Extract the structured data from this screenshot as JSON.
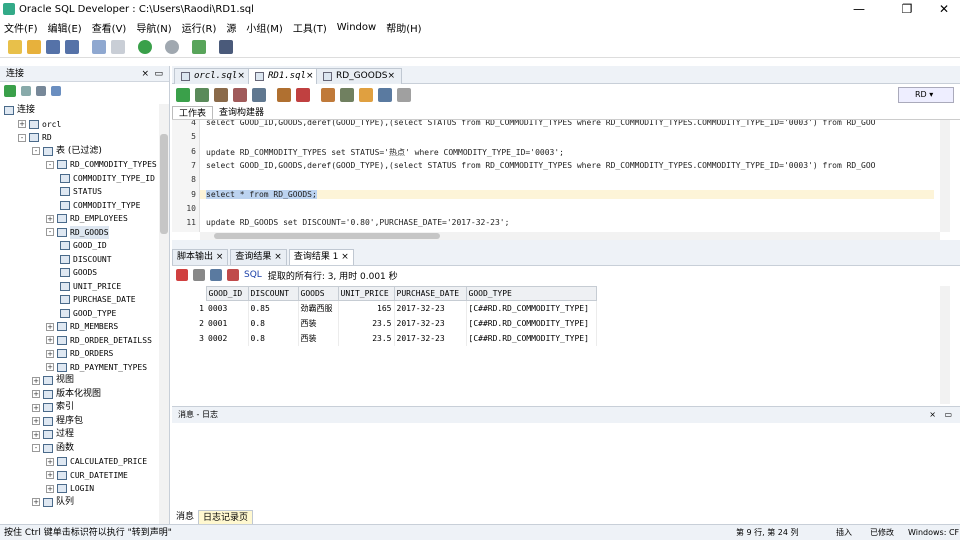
{
  "window": {
    "title": "Oracle SQL Developer : C:\\Users\\Raodi\\RD1.sql"
  },
  "menu": [
    "文件(F)",
    "编辑(E)",
    "查看(V)",
    "导航(N)",
    "运行(R)",
    "源",
    "小组(M)",
    "工具(T)",
    "Window",
    "帮助(H)"
  ],
  "connections": {
    "header": "连接",
    "tree": [
      {
        "label": "连接",
        "mono": false,
        "exp": "",
        "level": 0
      },
      {
        "label": "orcl",
        "mono": true,
        "exp": "+",
        "level": 1
      },
      {
        "label": "RD",
        "mono": true,
        "exp": "-",
        "level": 1
      },
      {
        "label": "表 (已过滤)",
        "mono": false,
        "exp": "-",
        "level": 2
      },
      {
        "label": "RD_COMMODITY_TYPES",
        "mono": true,
        "exp": "-",
        "level": 3
      },
      {
        "label": "COMMODITY_TYPE_ID",
        "mono": true,
        "exp": "",
        "level": 4
      },
      {
        "label": "STATUS",
        "mono": true,
        "exp": "",
        "level": 4
      },
      {
        "label": "COMMODITY_TYPE",
        "mono": true,
        "exp": "",
        "level": 4
      },
      {
        "label": "RD_EMPLOYEES",
        "mono": true,
        "exp": "+",
        "level": 3
      },
      {
        "label": "RD_GOODS",
        "mono": true,
        "exp": "-",
        "level": 3,
        "sel": true
      },
      {
        "label": "GOOD_ID",
        "mono": true,
        "exp": "",
        "level": 4
      },
      {
        "label": "DISCOUNT",
        "mono": true,
        "exp": "",
        "level": 4
      },
      {
        "label": "GOODS",
        "mono": true,
        "exp": "",
        "level": 4
      },
      {
        "label": "UNIT_PRICE",
        "mono": true,
        "exp": "",
        "level": 4
      },
      {
        "label": "PURCHASE_DATE",
        "mono": true,
        "exp": "",
        "level": 4
      },
      {
        "label": "GOOD_TYPE",
        "mono": true,
        "exp": "",
        "level": 4
      },
      {
        "label": "RD_MEMBERS",
        "mono": true,
        "exp": "+",
        "level": 3
      },
      {
        "label": "RD_ORDER_DETAILSS",
        "mono": true,
        "exp": "+",
        "level": 3
      },
      {
        "label": "RD_ORDERS",
        "mono": true,
        "exp": "+",
        "level": 3
      },
      {
        "label": "RD_PAYMENT_TYPES",
        "mono": true,
        "exp": "+",
        "level": 3
      },
      {
        "label": "视图",
        "mono": false,
        "exp": "+",
        "level": 2
      },
      {
        "label": "版本化视图",
        "mono": false,
        "exp": "+",
        "level": 2
      },
      {
        "label": "索引",
        "mono": false,
        "exp": "+",
        "level": 2
      },
      {
        "label": "程序包",
        "mono": false,
        "exp": "+",
        "level": 2
      },
      {
        "label": "过程",
        "mono": false,
        "exp": "+",
        "level": 2
      },
      {
        "label": "函数",
        "mono": false,
        "exp": "-",
        "level": 2
      },
      {
        "label": "CALCULATED_PRICE",
        "mono": true,
        "exp": "+",
        "level": 3
      },
      {
        "label": "CUR_DATETIME",
        "mono": true,
        "exp": "+",
        "level": 3
      },
      {
        "label": "LOGIN",
        "mono": true,
        "exp": "+",
        "level": 3
      },
      {
        "label": "队列",
        "mono": false,
        "exp": "+",
        "level": 2
      }
    ]
  },
  "editor_tabs": [
    {
      "label": "orcl.sql",
      "italic": true
    },
    {
      "label": "RD1.sql",
      "italic": true,
      "active": true
    },
    {
      "label": "RD_GOODS",
      "italic": false
    }
  ],
  "connection_select": "RD",
  "sub_tabs": [
    "工作表",
    "查询构建器"
  ],
  "code_lines": [
    {
      "n": "4",
      "text": "select GOOD_ID,GOODS,deref(GOOD_TYPE),(select STATUS from RD_COMMODITY_TYPES where RD_COMMODITY_TYPES.COMMODITY_TYPE_ID='0003') from RD_GOO"
    },
    {
      "n": "5",
      "text": ""
    },
    {
      "n": "6",
      "text": "update RD_COMMODITY_TYPES set STATUS='热点' where COMMODITY_TYPE_ID='0003';"
    },
    {
      "n": "7",
      "text": "select GOOD_ID,GOODS,deref(GOOD_TYPE),(select STATUS from RD_COMMODITY_TYPES where RD_COMMODITY_TYPES.COMMODITY_TYPE_ID='0003') from RD_GOO"
    },
    {
      "n": "8",
      "text": ""
    },
    {
      "n": "9",
      "text": "select * from RD_GOODS;",
      "hl": true
    },
    {
      "n": "10",
      "text": ""
    },
    {
      "n": "11",
      "text": "update RD_GOODS set  DISCOUNT='0.80',PURCHASE_DATE='2017-32-23';"
    }
  ],
  "result_tabs": [
    "脚本输出 ×",
    "查询结果 ×",
    "查询结果 1 ×"
  ],
  "result_toolbar": {
    "sql_label": "SQL",
    "status": "提取的所有行: 3, 用时 0.001 秒"
  },
  "grid": {
    "columns": [
      "GOOD_ID",
      "DISCOUNT",
      "GOODS",
      "UNIT_PRICE",
      "PURCHASE_DATE",
      "GOOD_TYPE"
    ],
    "rows": [
      {
        "n": "1",
        "cells": [
          "0003",
          "0.85",
          "劲霸西服",
          "165",
          "2017-32-23",
          "[C##RD.RD_COMMODITY_TYPE]"
        ]
      },
      {
        "n": "2",
        "cells": [
          "0001",
          "0.8",
          "西装",
          "23.5",
          "2017-32-23",
          "[C##RD.RD_COMMODITY_TYPE]"
        ]
      },
      {
        "n": "3",
        "cells": [
          "0002",
          "0.8",
          "西装",
          "23.5",
          "2017-32-23",
          "[C##RD.RD_COMMODITY_TYPE]"
        ]
      }
    ]
  },
  "log": {
    "header": "消息 - 日志"
  },
  "bottom_tabs": [
    "消息",
    "日志记录页"
  ],
  "status": {
    "left": "按住 Ctrl 键单击标识符以执行 \"转到声明\"",
    "position": "第 9 行, 第 24 列",
    "mode": "插入",
    "modified": "已修改",
    "os": "Windows: CF"
  }
}
